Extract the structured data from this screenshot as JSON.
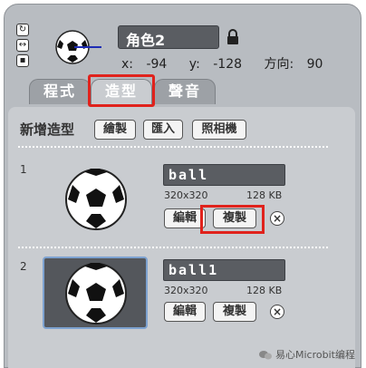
{
  "sprite": {
    "name": "角色2",
    "x_label": "x:",
    "x_value": "-94",
    "y_label": "y:",
    "y_value": "-128",
    "direction_label": "方向:",
    "direction_value": "90",
    "side_icons": [
      "rotate-icon",
      "flip-icon",
      "no-rotate-icon"
    ]
  },
  "tabs": [
    {
      "label": "程式",
      "active": false
    },
    {
      "label": "造型",
      "active": true
    },
    {
      "label": "聲音",
      "active": false
    }
  ],
  "new_costume": {
    "label": "新增造型",
    "buttons": [
      "繪製",
      "匯入",
      "照相機"
    ]
  },
  "costumes": [
    {
      "index": "1",
      "name": "ball",
      "size": "320x320",
      "bytes": "128 KB",
      "edit": "編輯",
      "copy": "複製",
      "selected": false
    },
    {
      "index": "2",
      "name": "ball1",
      "size": "320x320",
      "bytes": "128 KB",
      "edit": "編輯",
      "copy": "複製",
      "selected": true
    }
  ],
  "watermark": "易心Microbit编程",
  "colors": {
    "highlight": "#e0221c",
    "panel": "#c9ccd0",
    "field": "#5a5d62"
  }
}
